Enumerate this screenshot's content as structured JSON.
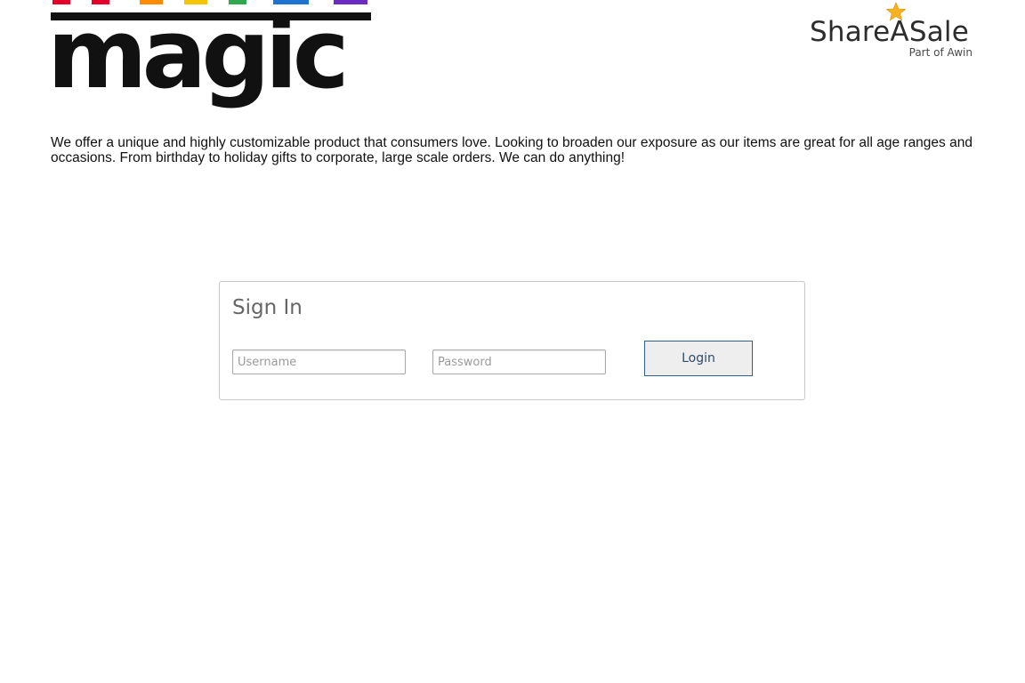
{
  "merchant": {
    "logo_text": "magic",
    "logo_strip_colors": [
      "#e4002b",
      "#ff8c00",
      "#f2c500",
      "#2fa84f",
      "#1e74d2",
      "#6a2bc2"
    ]
  },
  "network": {
    "name": "ShareASale",
    "tagline": "Part of Awin",
    "star_color": "#f5b324"
  },
  "description": {
    "text": "We offer a unique and highly customizable product that consumers love. Looking to broaden our exposure as our items are great for all age ranges and occasions. From birthday to holiday gifts to corporate, large scale orders. We can do anything!"
  },
  "signin": {
    "title": "Sign In",
    "username_placeholder": "Username",
    "password_placeholder": "Password",
    "login_label": "Login"
  }
}
